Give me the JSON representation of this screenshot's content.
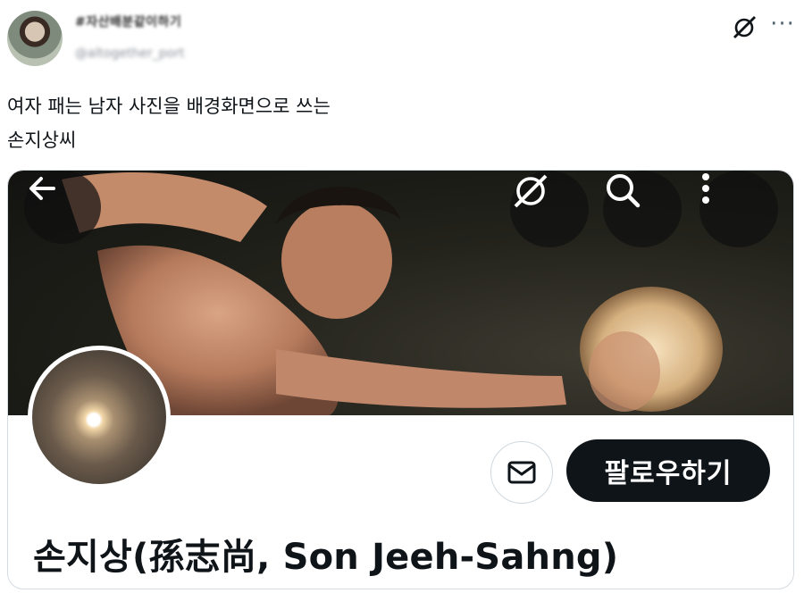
{
  "tweet": {
    "author_name": "#자산배분같이하기",
    "author_handle": "@altogether_port",
    "text_line1": "여자 패는 남자 사진을 배경화면으로 쓰는",
    "text_line2": "손지상씨"
  },
  "top_icons": {
    "grok": "grok-icon",
    "more": "···"
  },
  "profile_card": {
    "display_name": "손지상(孫志尚, Son Jeeh-Sahng)",
    "follow_label": "팔로우하기",
    "icons": [
      "back-arrow-icon",
      "grok-icon",
      "search-icon",
      "more-vertical-icon",
      "mail-icon"
    ]
  },
  "colors": {
    "text": "#0f1419",
    "follow_button_bg": "#0f1419",
    "follow_button_text": "#ffffff",
    "overlay_button_bg": "#1a1a1a"
  }
}
